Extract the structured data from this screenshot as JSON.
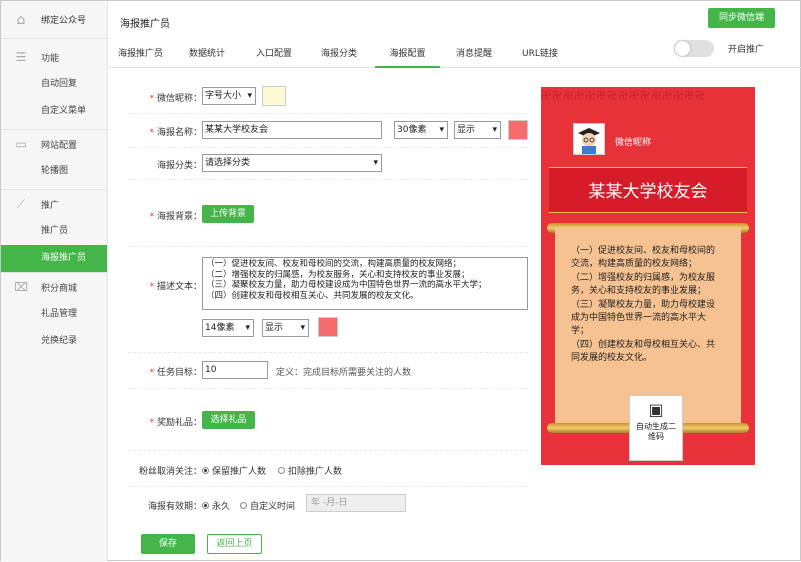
{
  "sidebar": {
    "top": {
      "icon": "home-icon",
      "label": "绑定公众号"
    },
    "sections": [
      {
        "icon": "menu-icon",
        "label": "功能",
        "items": [
          "自动回复",
          "自定义菜单"
        ]
      },
      {
        "icon": "inbox-icon",
        "label": "网站配置",
        "items": [
          "轮播图"
        ]
      },
      {
        "icon": "chart-line-icon",
        "label": "推广",
        "items": [
          "推广员",
          "海报推广员"
        ]
      },
      {
        "icon": "gift-icon",
        "label": "积分商城",
        "items": [
          "礼品管理",
          "兑换纪录"
        ]
      }
    ],
    "active_item": "海报推广员"
  },
  "header": {
    "title": "海报推广员",
    "sync_button": "同步微信端",
    "tabs": [
      "海报推广员",
      "数据统计",
      "入口配置",
      "海报分类",
      "海报配置",
      "消息提醒",
      "URL链接"
    ],
    "active_tab": "海报配置",
    "toggle_label": "开启推广",
    "toggle_on": false
  },
  "form": {
    "nickname": {
      "label": "微信昵称：",
      "font_size": "字号大小",
      "color": "#fffad6"
    },
    "poster_name": {
      "label": "海报名称：",
      "value": "某某大学校友会",
      "font_size": "30像素",
      "display": "显示",
      "color": "#f56c6c"
    },
    "poster_category": {
      "label": "海报分类：",
      "value": "请选择分类"
    },
    "poster_background": {
      "label": "海报背景：",
      "button": "上传背景"
    },
    "description": {
      "label": "描述文本：",
      "lines": [
        "（一）促进校友间、校友和母校间的交流，构建高质量的校友网络；",
        "（二）增强校友的归属感，为校友服务，关心和支持校友的事业发展；",
        "（三）凝聚校友力量，助力母校建设成为中国特色世界一流的高水平大学；",
        "（四）创建校友和母校相互关心、共同发展的校友文化。"
      ],
      "font_size": "14像素",
      "display": "显示",
      "color": "#f56c6c"
    },
    "task_goal": {
      "label": "任务目标：",
      "value": "10",
      "hint": "定义：完成目标所需要关注的人数"
    },
    "reward": {
      "label": "奖励礼品：",
      "button": "选择礼品"
    },
    "unfollow": {
      "label": "粉丝取消关注：",
      "options": [
        "保留推广人数",
        "扣除推广人数"
      ],
      "selected": 0
    },
    "validity": {
      "label": "海报有效期：",
      "options": [
        "永久",
        "自定义时间"
      ],
      "selected": 0,
      "date_placeholder": "年 -月-日"
    },
    "save_button": "保存",
    "back_button": "返回上页"
  },
  "poster": {
    "nickname": "微信昵称",
    "title": "某某大学校友会",
    "text_lines": [
      "（一）促进校友间、校友和母校间的交流，构建高质量的校友网络；",
      "（二）增强校友的归属感，为校友服务，关心和支持校友的事业发展；",
      "（三）凝聚校友力量，助力母校建设成为中国特色世界一流的高水平大学；",
      "（四）创建校友和母校相互关心、共同发展的校友文化。"
    ],
    "qr_label": "自动生成二维码",
    "colors": {
      "background": "#e7323a",
      "scroll": "#f6c291",
      "accent": "#44b549"
    }
  }
}
